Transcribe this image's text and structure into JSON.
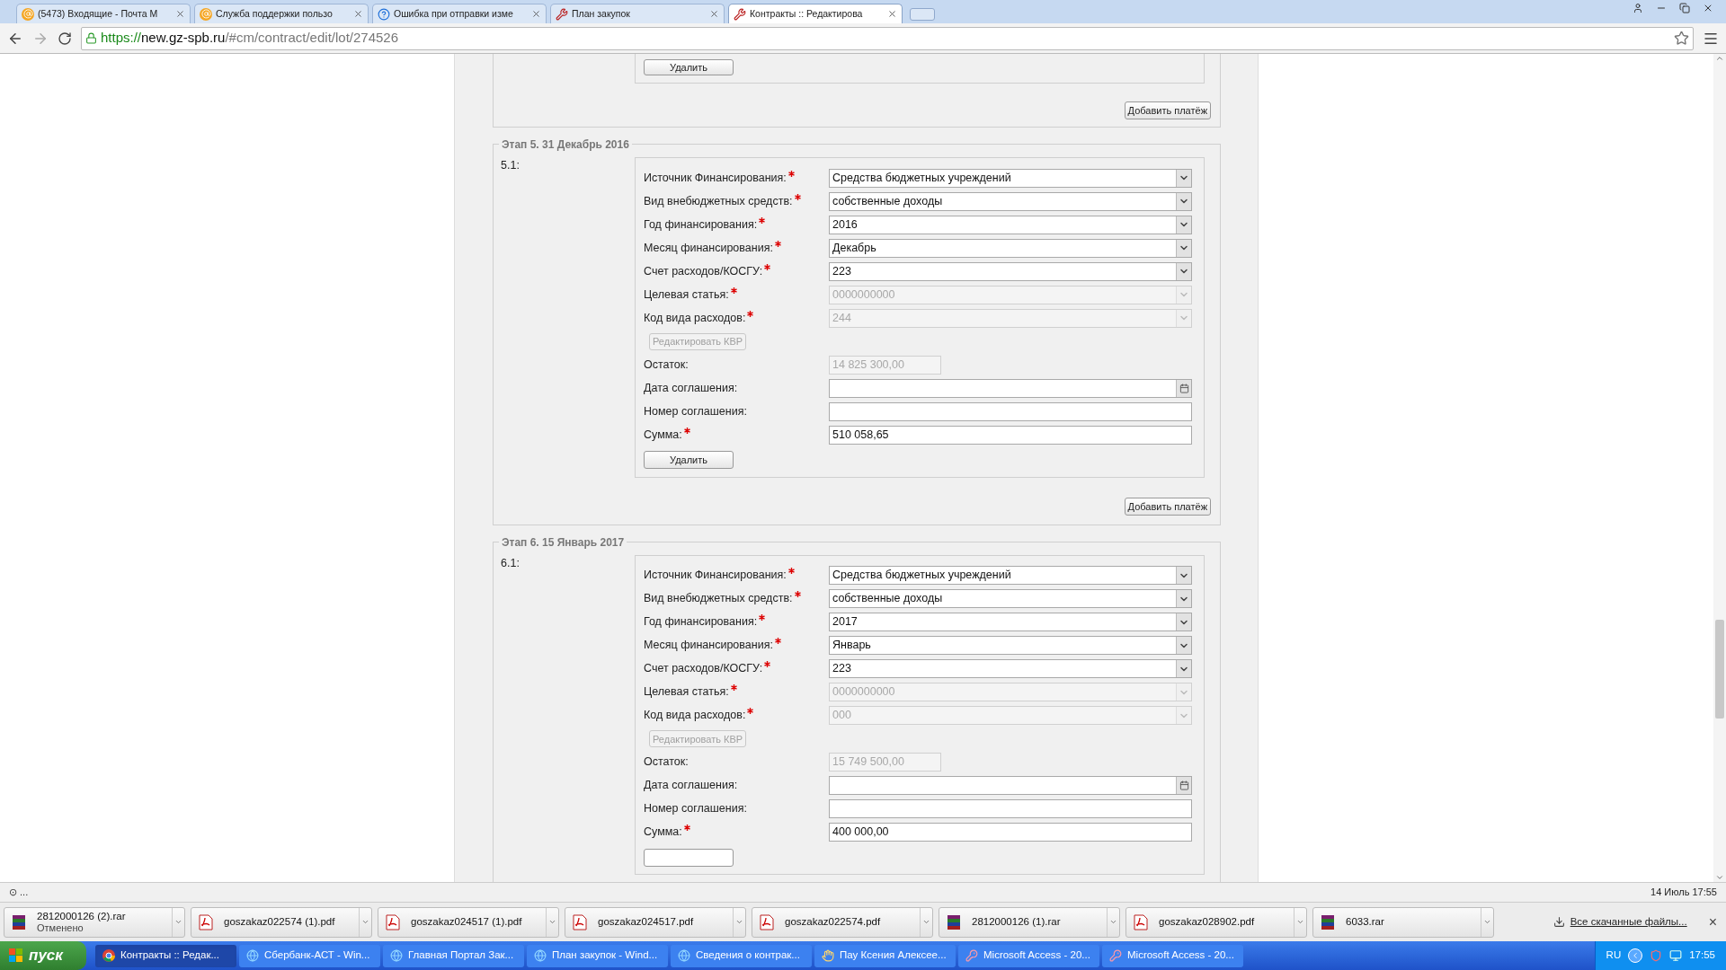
{
  "browser": {
    "tabs": [
      {
        "label": "(5473) Входящие - Почта М",
        "kind": "mail",
        "selected": false
      },
      {
        "label": "Служба поддержки пользо",
        "kind": "mail",
        "selected": false
      },
      {
        "label": "Ошибка при отправки изме",
        "kind": "help",
        "selected": false
      },
      {
        "label": "План закупок",
        "kind": "tools",
        "selected": false
      },
      {
        "label": "Контракты :: Редактирова",
        "kind": "tools",
        "selected": true
      }
    ],
    "url": {
      "scheme": "https://",
      "host": "new.gz-spb.ru",
      "path": "/#cm/contract/edit/lot/274526"
    }
  },
  "previous_stage": {
    "delete_button": "Удалить",
    "add_payment_button": "Добавить платёж"
  },
  "stages": [
    {
      "legend": "Этап 5. 31 Декабрь 2016",
      "add_payment_button": "Добавить платёж",
      "payments": [
        {
          "number": "5.1:",
          "delete_button": "Удалить",
          "fields": [
            {
              "kind": "select",
              "label": "Источник Финансирования:",
              "required": true,
              "value": "Средства бюджетных учреждений",
              "disabled": false
            },
            {
              "kind": "select",
              "label": "Вид внебюджетных средств:",
              "required": true,
              "value": "собственные доходы",
              "disabled": false
            },
            {
              "kind": "select",
              "label": "Год финансирования:",
              "required": true,
              "value": "2016",
              "disabled": false
            },
            {
              "kind": "select",
              "label": "Месяц финансирования:",
              "required": true,
              "value": "Декабрь",
              "disabled": false
            },
            {
              "kind": "select",
              "label": "Счет расходов/КОСГУ:",
              "required": true,
              "value": "223",
              "disabled": false
            },
            {
              "kind": "select",
              "label": "Целевая статья:",
              "required": true,
              "value": "0000000000",
              "disabled": true
            },
            {
              "kind": "select",
              "label": "Код вида расходов:",
              "required": true,
              "value": "244",
              "disabled": true
            },
            {
              "kind": "button",
              "label": "Редактировать КВР",
              "disabled": true
            },
            {
              "kind": "short",
              "label": "Остаток:",
              "required": false,
              "value": "14 825 300,00",
              "disabled": true
            },
            {
              "kind": "date",
              "label": "Дата соглашения:",
              "required": false,
              "disabled": false
            },
            {
              "kind": "text",
              "label": "Номер соглашения:",
              "required": false,
              "disabled": false
            },
            {
              "kind": "text",
              "label": "Сумма:",
              "required": true,
              "value": "510 058,65",
              "disabled": false
            }
          ]
        }
      ]
    },
    {
      "legend": "Этап 6. 15 Январь 2017",
      "payments": [
        {
          "number": "6.1:",
          "fields": [
            {
              "kind": "select",
              "label": "Источник Финансирования:",
              "required": true,
              "value": "Средства бюджетных учреждений",
              "disabled": false
            },
            {
              "kind": "select",
              "label": "Вид внебюджетных средств:",
              "required": true,
              "value": "собственные доходы",
              "disabled": false
            },
            {
              "kind": "select",
              "label": "Год финансирования:",
              "required": true,
              "value": "2017",
              "disabled": false
            },
            {
              "kind": "select",
              "label": "Месяц финансирования:",
              "required": true,
              "value": "Январь",
              "disabled": false
            },
            {
              "kind": "select",
              "label": "Счет расходов/КОСГУ:",
              "required": true,
              "value": "223",
              "disabled": false
            },
            {
              "kind": "select",
              "label": "Целевая статья:",
              "required": true,
              "value": "0000000000",
              "disabled": true
            },
            {
              "kind": "select",
              "label": "Код вида расходов:",
              "required": true,
              "value": "000",
              "disabled": true
            },
            {
              "kind": "button",
              "label": "Редактировать КВР",
              "disabled": true
            },
            {
              "kind": "short",
              "label": "Остаток:",
              "required": false,
              "value": "15 749 500,00",
              "disabled": true
            },
            {
              "kind": "date",
              "label": "Дата соглашения:",
              "required": false,
              "disabled": false
            },
            {
              "kind": "text",
              "label": "Номер соглашения:",
              "required": false,
              "disabled": false
            },
            {
              "kind": "text",
              "label": "Сумма:",
              "required": true,
              "value": "400 000,00",
              "disabled": false
            }
          ]
        }
      ]
    }
  ],
  "status_bar": {
    "left": "⊙ ...",
    "right": "14 Июль 17:55"
  },
  "downloads": {
    "items": [
      {
        "name": "2812000126 (2).rar",
        "kind": "rar",
        "status": "Отменено"
      },
      {
        "name": "goszakaz022574 (1).pdf",
        "kind": "pdf"
      },
      {
        "name": "goszakaz024517 (1).pdf",
        "kind": "pdf"
      },
      {
        "name": "goszakaz024517.pdf",
        "kind": "pdf"
      },
      {
        "name": "goszakaz022574.pdf",
        "kind": "pdf"
      },
      {
        "name": "2812000126 (1).rar",
        "kind": "rar"
      },
      {
        "name": "goszakaz028902.pdf",
        "kind": "pdf"
      },
      {
        "name": "6033.rar",
        "kind": "rar"
      }
    ],
    "all_link": "Все скачанные файлы...",
    "close": "×"
  },
  "taskbar": {
    "start": "пуск",
    "items": [
      {
        "label": "Контракты :: Редак...",
        "kind": "chrome",
        "selected": true
      },
      {
        "label": "Сбербанк-АСТ - Win...",
        "kind": "ie",
        "selected": false
      },
      {
        "label": "Главная Портал Зак...",
        "kind": "ie",
        "selected": false
      },
      {
        "label": "План закупок - Wind...",
        "kind": "ie",
        "selected": false
      },
      {
        "label": "Сведения о контрак...",
        "kind": "ie",
        "selected": false
      },
      {
        "label": "Пау Ксения Алексее...",
        "kind": "hand",
        "selected": false
      },
      {
        "label": "Microsoft Access - 20...",
        "kind": "access",
        "selected": false
      },
      {
        "label": "Microsoft Access - 20...",
        "kind": "access",
        "selected": false
      }
    ],
    "language": "RU",
    "clock": "17:55"
  }
}
